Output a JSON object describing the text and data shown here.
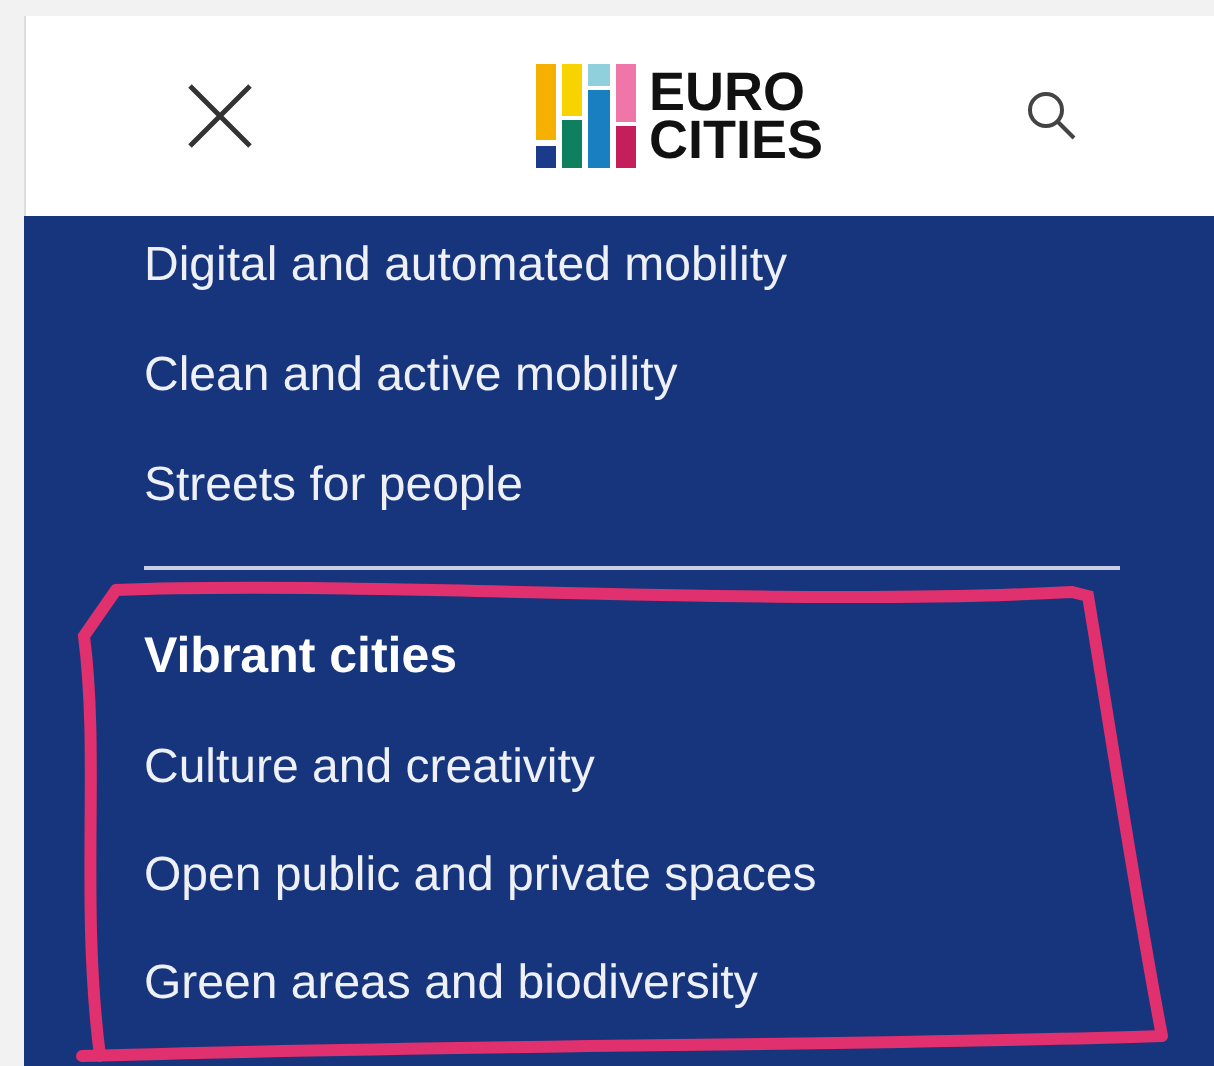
{
  "header": {
    "logo_lines": [
      "EURO",
      "CITIES"
    ]
  },
  "menu": {
    "items": [
      {
        "label": "Digital and automated mobility",
        "kind": "link"
      },
      {
        "label": "Clean and active mobility",
        "kind": "link"
      },
      {
        "label": "Streets for people",
        "kind": "link"
      }
    ],
    "section": {
      "heading": "Vibrant cities",
      "items": [
        {
          "label": "Culture and creativity",
          "kind": "link"
        },
        {
          "label": "Open public and private spaces",
          "kind": "link"
        },
        {
          "label": "Green areas and biodiversity",
          "kind": "link"
        }
      ]
    }
  }
}
